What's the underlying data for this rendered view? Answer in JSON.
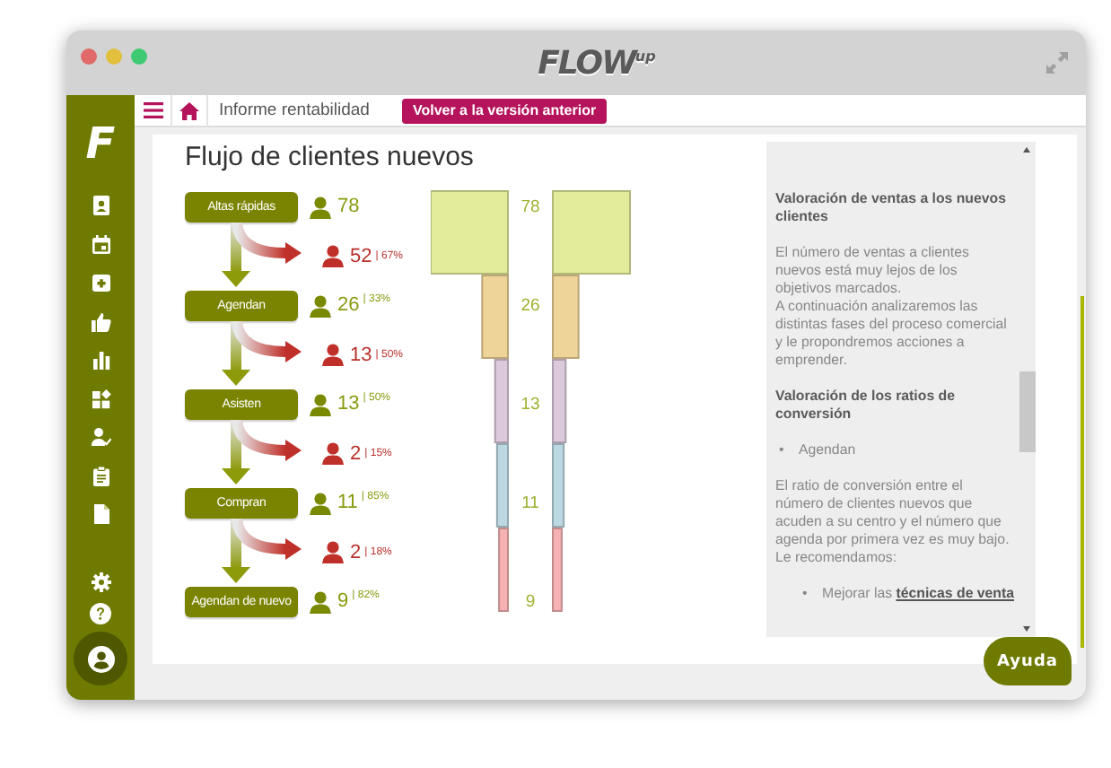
{
  "window": {
    "logo": "FLOW",
    "logo_suffix": "up"
  },
  "toolbar": {
    "title": "Informe rentabilidad",
    "back_button": "Volver a la versión anterior"
  },
  "sidebar": {
    "logo_letter": "F"
  },
  "report": {
    "title": "Flujo de clientes nuevos",
    "steps": [
      {
        "label": "Altas rápidas",
        "count": "78"
      },
      {
        "label": "Agendan",
        "count": "26",
        "share": "| 33%"
      },
      {
        "label": "Asisten",
        "count": "13",
        "share": "| 50%"
      },
      {
        "label": "Compran",
        "count": "11",
        "share": "| 85%"
      },
      {
        "label": "Agendan de nuevo",
        "count": "9",
        "share": "| 82%"
      }
    ],
    "losses": [
      {
        "count": "52",
        "share": "| 67%"
      },
      {
        "count": "13",
        "share": "| 50%"
      },
      {
        "count": "2",
        "share": "| 15%"
      },
      {
        "count": "2",
        "share": "| 18%"
      }
    ],
    "funnel_bars": [
      {
        "label": "78",
        "color": "#e3ec9a"
      },
      {
        "label": "26",
        "color": "#efd49a"
      },
      {
        "label": "13",
        "color": "#dccadc"
      },
      {
        "label": "11",
        "color": "#bcd8e2"
      },
      {
        "label": "9",
        "color": "#f6b2b2"
      }
    ]
  },
  "help_panel": {
    "blocks": [
      {
        "kind": "heading",
        "lines": [
          "Valoración de ventas a los nuevos clientes"
        ]
      },
      {
        "kind": "paragraph",
        "lines": [
          "El número de ventas a clientes nuevos está muy lejos de los objetivos marcados.",
          "A continuación analizaremos las distintas fases del proceso comercial y le propondremos acciones a emprender."
        ]
      },
      {
        "kind": "heading",
        "lines": [
          "Valoración de los ratios de conversión"
        ]
      },
      {
        "kind": "bullet",
        "marker": "•",
        "text": "Agendan"
      },
      {
        "kind": "paragraph",
        "lines": [
          "El ratio de conversión entre el número de clientes nuevos que acuden a su centro y el número que agenda por primera vez es muy bajo.",
          "Le recomendamos:"
        ]
      },
      {
        "kind": "link_bullet",
        "marker": "•",
        "text": "Mejorar las",
        "link": "técnicas de venta"
      }
    ]
  },
  "help_button": "Ayuda"
}
